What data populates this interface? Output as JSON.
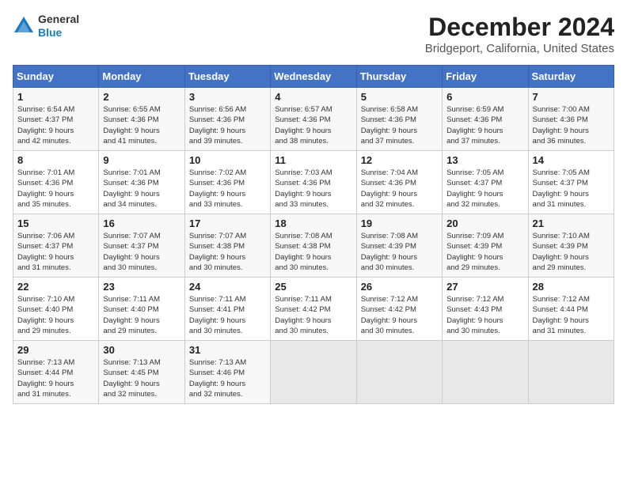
{
  "logo": {
    "general": "General",
    "blue": "Blue"
  },
  "title": "December 2024",
  "subtitle": "Bridgeport, California, United States",
  "days_of_week": [
    "Sunday",
    "Monday",
    "Tuesday",
    "Wednesday",
    "Thursday",
    "Friday",
    "Saturday"
  ],
  "weeks": [
    [
      {
        "day": "1",
        "sunrise": "6:54 AM",
        "sunset": "4:37 PM",
        "daylight": "9 hours and 42 minutes."
      },
      {
        "day": "2",
        "sunrise": "6:55 AM",
        "sunset": "4:36 PM",
        "daylight": "9 hours and 41 minutes."
      },
      {
        "day": "3",
        "sunrise": "6:56 AM",
        "sunset": "4:36 PM",
        "daylight": "9 hours and 39 minutes."
      },
      {
        "day": "4",
        "sunrise": "6:57 AM",
        "sunset": "4:36 PM",
        "daylight": "9 hours and 38 minutes."
      },
      {
        "day": "5",
        "sunrise": "6:58 AM",
        "sunset": "4:36 PM",
        "daylight": "9 hours and 37 minutes."
      },
      {
        "day": "6",
        "sunrise": "6:59 AM",
        "sunset": "4:36 PM",
        "daylight": "9 hours and 37 minutes."
      },
      {
        "day": "7",
        "sunrise": "7:00 AM",
        "sunset": "4:36 PM",
        "daylight": "9 hours and 36 minutes."
      }
    ],
    [
      {
        "day": "8",
        "sunrise": "7:01 AM",
        "sunset": "4:36 PM",
        "daylight": "9 hours and 35 minutes."
      },
      {
        "day": "9",
        "sunrise": "7:01 AM",
        "sunset": "4:36 PM",
        "daylight": "9 hours and 34 minutes."
      },
      {
        "day": "10",
        "sunrise": "7:02 AM",
        "sunset": "4:36 PM",
        "daylight": "9 hours and 33 minutes."
      },
      {
        "day": "11",
        "sunrise": "7:03 AM",
        "sunset": "4:36 PM",
        "daylight": "9 hours and 33 minutes."
      },
      {
        "day": "12",
        "sunrise": "7:04 AM",
        "sunset": "4:36 PM",
        "daylight": "9 hours and 32 minutes."
      },
      {
        "day": "13",
        "sunrise": "7:05 AM",
        "sunset": "4:37 PM",
        "daylight": "9 hours and 32 minutes."
      },
      {
        "day": "14",
        "sunrise": "7:05 AM",
        "sunset": "4:37 PM",
        "daylight": "9 hours and 31 minutes."
      }
    ],
    [
      {
        "day": "15",
        "sunrise": "7:06 AM",
        "sunset": "4:37 PM",
        "daylight": "9 hours and 31 minutes."
      },
      {
        "day": "16",
        "sunrise": "7:07 AM",
        "sunset": "4:37 PM",
        "daylight": "9 hours and 30 minutes."
      },
      {
        "day": "17",
        "sunrise": "7:07 AM",
        "sunset": "4:38 PM",
        "daylight": "9 hours and 30 minutes."
      },
      {
        "day": "18",
        "sunrise": "7:08 AM",
        "sunset": "4:38 PM",
        "daylight": "9 hours and 30 minutes."
      },
      {
        "day": "19",
        "sunrise": "7:08 AM",
        "sunset": "4:39 PM",
        "daylight": "9 hours and 30 minutes."
      },
      {
        "day": "20",
        "sunrise": "7:09 AM",
        "sunset": "4:39 PM",
        "daylight": "9 hours and 29 minutes."
      },
      {
        "day": "21",
        "sunrise": "7:10 AM",
        "sunset": "4:39 PM",
        "daylight": "9 hours and 29 minutes."
      }
    ],
    [
      {
        "day": "22",
        "sunrise": "7:10 AM",
        "sunset": "4:40 PM",
        "daylight": "9 hours and 29 minutes."
      },
      {
        "day": "23",
        "sunrise": "7:11 AM",
        "sunset": "4:40 PM",
        "daylight": "9 hours and 29 minutes."
      },
      {
        "day": "24",
        "sunrise": "7:11 AM",
        "sunset": "4:41 PM",
        "daylight": "9 hours and 30 minutes."
      },
      {
        "day": "25",
        "sunrise": "7:11 AM",
        "sunset": "4:42 PM",
        "daylight": "9 hours and 30 minutes."
      },
      {
        "day": "26",
        "sunrise": "7:12 AM",
        "sunset": "4:42 PM",
        "daylight": "9 hours and 30 minutes."
      },
      {
        "day": "27",
        "sunrise": "7:12 AM",
        "sunset": "4:43 PM",
        "daylight": "9 hours and 30 minutes."
      },
      {
        "day": "28",
        "sunrise": "7:12 AM",
        "sunset": "4:44 PM",
        "daylight": "9 hours and 31 minutes."
      }
    ],
    [
      {
        "day": "29",
        "sunrise": "7:13 AM",
        "sunset": "4:44 PM",
        "daylight": "9 hours and 31 minutes."
      },
      {
        "day": "30",
        "sunrise": "7:13 AM",
        "sunset": "4:45 PM",
        "daylight": "9 hours and 32 minutes."
      },
      {
        "day": "31",
        "sunrise": "7:13 AM",
        "sunset": "4:46 PM",
        "daylight": "9 hours and 32 minutes."
      },
      null,
      null,
      null,
      null
    ]
  ],
  "labels": {
    "sunrise": "Sunrise:",
    "sunset": "Sunset:",
    "daylight": "Daylight hours"
  }
}
